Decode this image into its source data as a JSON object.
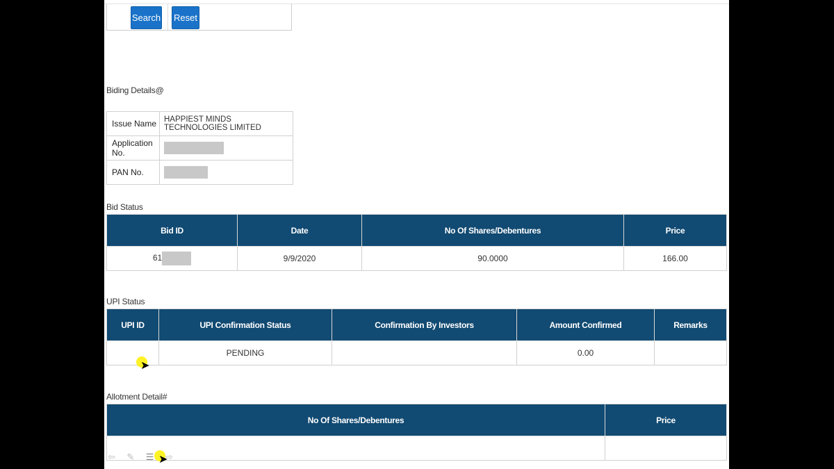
{
  "search": {
    "search_label": "Search",
    "reset_label": "Reset"
  },
  "bidding_details": {
    "label": "Biding Details@",
    "rows": [
      {
        "key": "Issue Name",
        "value": "HAPPIEST MINDS TECHNOLOGIES LIMITED"
      },
      {
        "key": "Application No.",
        "value": ""
      },
      {
        "key": "PAN No.",
        "value": ""
      }
    ]
  },
  "bid_status": {
    "label": "Bid Status",
    "headers": [
      "Bid ID",
      "Date",
      "No Of Shares/Debentures",
      "Price"
    ],
    "row": {
      "bid_id_prefix": "61",
      "date": "9/9/2020",
      "shares": "90.0000",
      "price": "166.00"
    }
  },
  "upi_status": {
    "label": "UPI Status",
    "headers": [
      "UPI ID",
      "UPI Confirmation Status",
      "Confirmation By Investors",
      "Amount Confirmed",
      "Remarks"
    ],
    "row": {
      "upi_id": "",
      "status": "PENDING",
      "confirmation": "",
      "amount": "0.00",
      "remarks": ""
    }
  },
  "allotment": {
    "label": "Allotment Detail#",
    "headers": [
      "No Of Shares/Debentures",
      "Price"
    ]
  },
  "colors": {
    "header_bg": "#114a72",
    "button_bg": "#1a73c9",
    "highlight": "#fff000"
  },
  "icons": [
    "back-arrow-icon",
    "edit-icon",
    "list-icon",
    "forward-arrow-icon",
    "mouse-pointer-icon"
  ]
}
